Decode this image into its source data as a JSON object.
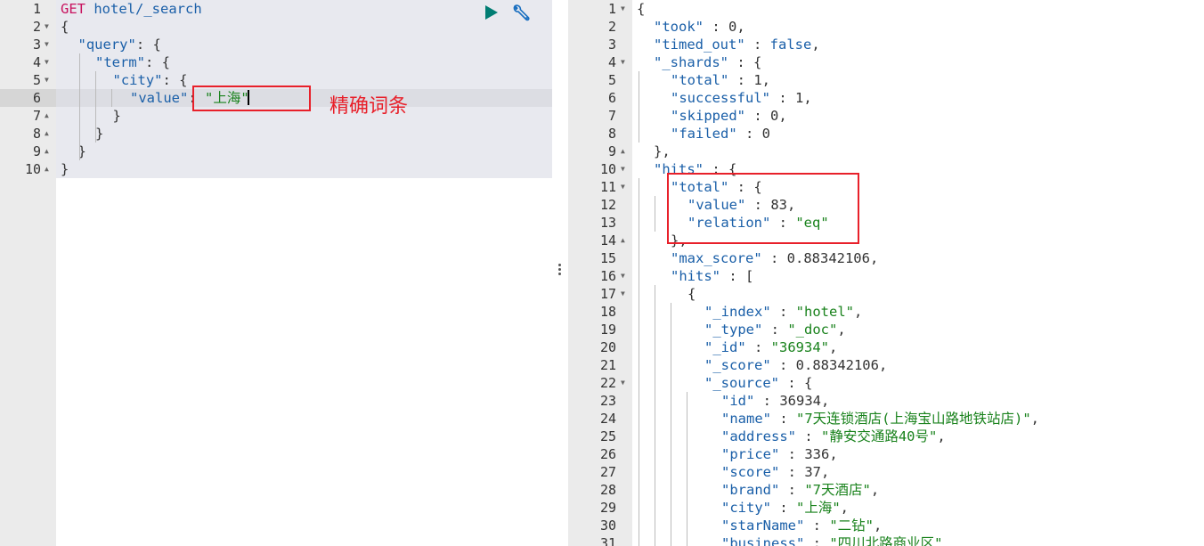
{
  "request_editor": {
    "active_line": 6,
    "lines": [
      {
        "n": "1",
        "fold": "",
        "indent": 0,
        "tokens": [
          {
            "t": "method",
            "v": "GET"
          },
          {
            "t": "punc",
            "v": " "
          },
          {
            "t": "url",
            "v": "hotel/_search"
          }
        ]
      },
      {
        "n": "2",
        "fold": "▼",
        "indent": 0,
        "tokens": [
          {
            "t": "punc",
            "v": "{"
          }
        ]
      },
      {
        "n": "3",
        "fold": "▼",
        "indent": 1,
        "tokens": [
          {
            "t": "key",
            "v": "\"query\""
          },
          {
            "t": "punc",
            "v": ": {"
          }
        ]
      },
      {
        "n": "4",
        "fold": "▼",
        "indent": 2,
        "tokens": [
          {
            "t": "key",
            "v": "\"term\""
          },
          {
            "t": "punc",
            "v": ": {"
          }
        ]
      },
      {
        "n": "5",
        "fold": "▼",
        "indent": 3,
        "tokens": [
          {
            "t": "key",
            "v": "\"city\""
          },
          {
            "t": "punc",
            "v": ": {"
          }
        ]
      },
      {
        "n": "6",
        "fold": "",
        "indent": 4,
        "tokens": [
          {
            "t": "key",
            "v": "\"value\""
          },
          {
            "t": "punc",
            "v": ": "
          },
          {
            "t": "str",
            "v": "\"上海\""
          }
        ]
      },
      {
        "n": "7",
        "fold": "▲",
        "indent": 3,
        "tokens": [
          {
            "t": "punc",
            "v": "}"
          }
        ]
      },
      {
        "n": "8",
        "fold": "▲",
        "indent": 2,
        "tokens": [
          {
            "t": "punc",
            "v": "}"
          }
        ]
      },
      {
        "n": "9",
        "fold": "▲",
        "indent": 1,
        "tokens": [
          {
            "t": "punc",
            "v": "}"
          }
        ]
      },
      {
        "n": "10",
        "fold": "▲",
        "indent": 0,
        "tokens": [
          {
            "t": "punc",
            "v": "}"
          }
        ]
      }
    ]
  },
  "toolbar": {
    "run_icon": "play-icon",
    "settings_icon": "wrench-icon",
    "run_color": "#017d73",
    "settings_color": "#1a6fc0"
  },
  "annotation": {
    "label": "精确词条",
    "color": "#e8202a"
  },
  "response_editor": {
    "lines": [
      {
        "n": "1",
        "fold": "▼",
        "indent": 0,
        "tokens": [
          {
            "t": "punc",
            "v": "{"
          }
        ]
      },
      {
        "n": "2",
        "fold": "",
        "indent": 1,
        "tokens": [
          {
            "t": "key",
            "v": "\"took\""
          },
          {
            "t": "punc",
            "v": " : "
          },
          {
            "t": "num",
            "v": "0"
          },
          {
            "t": "punc",
            "v": ","
          }
        ]
      },
      {
        "n": "3",
        "fold": "",
        "indent": 1,
        "tokens": [
          {
            "t": "key",
            "v": "\"timed_out\""
          },
          {
            "t": "punc",
            "v": " : "
          },
          {
            "t": "kw",
            "v": "false"
          },
          {
            "t": "punc",
            "v": ","
          }
        ]
      },
      {
        "n": "4",
        "fold": "▼",
        "indent": 1,
        "tokens": [
          {
            "t": "key",
            "v": "\"_shards\""
          },
          {
            "t": "punc",
            "v": " : {"
          }
        ]
      },
      {
        "n": "5",
        "fold": "",
        "indent": 2,
        "tokens": [
          {
            "t": "key",
            "v": "\"total\""
          },
          {
            "t": "punc",
            "v": " : "
          },
          {
            "t": "num",
            "v": "1"
          },
          {
            "t": "punc",
            "v": ","
          }
        ]
      },
      {
        "n": "6",
        "fold": "",
        "indent": 2,
        "tokens": [
          {
            "t": "key",
            "v": "\"successful\""
          },
          {
            "t": "punc",
            "v": " : "
          },
          {
            "t": "num",
            "v": "1"
          },
          {
            "t": "punc",
            "v": ","
          }
        ]
      },
      {
        "n": "7",
        "fold": "",
        "indent": 2,
        "tokens": [
          {
            "t": "key",
            "v": "\"skipped\""
          },
          {
            "t": "punc",
            "v": " : "
          },
          {
            "t": "num",
            "v": "0"
          },
          {
            "t": "punc",
            "v": ","
          }
        ]
      },
      {
        "n": "8",
        "fold": "",
        "indent": 2,
        "tokens": [
          {
            "t": "key",
            "v": "\"failed\""
          },
          {
            "t": "punc",
            "v": " : "
          },
          {
            "t": "num",
            "v": "0"
          }
        ]
      },
      {
        "n": "9",
        "fold": "▲",
        "indent": 1,
        "tokens": [
          {
            "t": "punc",
            "v": "},"
          }
        ]
      },
      {
        "n": "10",
        "fold": "▼",
        "indent": 1,
        "tokens": [
          {
            "t": "key",
            "v": "\"hits\""
          },
          {
            "t": "punc",
            "v": " : {"
          }
        ]
      },
      {
        "n": "11",
        "fold": "▼",
        "indent": 2,
        "tokens": [
          {
            "t": "key",
            "v": "\"total\""
          },
          {
            "t": "punc",
            "v": " : {"
          }
        ]
      },
      {
        "n": "12",
        "fold": "",
        "indent": 3,
        "tokens": [
          {
            "t": "key",
            "v": "\"value\""
          },
          {
            "t": "punc",
            "v": " : "
          },
          {
            "t": "num",
            "v": "83"
          },
          {
            "t": "punc",
            "v": ","
          }
        ]
      },
      {
        "n": "13",
        "fold": "",
        "indent": 3,
        "tokens": [
          {
            "t": "key",
            "v": "\"relation\""
          },
          {
            "t": "punc",
            "v": " : "
          },
          {
            "t": "str",
            "v": "\"eq\""
          }
        ]
      },
      {
        "n": "14",
        "fold": "▲",
        "indent": 2,
        "tokens": [
          {
            "t": "punc",
            "v": "},"
          }
        ]
      },
      {
        "n": "15",
        "fold": "",
        "indent": 2,
        "tokens": [
          {
            "t": "key",
            "v": "\"max_score\""
          },
          {
            "t": "punc",
            "v": " : "
          },
          {
            "t": "num",
            "v": "0.88342106"
          },
          {
            "t": "punc",
            "v": ","
          }
        ]
      },
      {
        "n": "16",
        "fold": "▼",
        "indent": 2,
        "tokens": [
          {
            "t": "key",
            "v": "\"hits\""
          },
          {
            "t": "punc",
            "v": " : ["
          }
        ]
      },
      {
        "n": "17",
        "fold": "▼",
        "indent": 3,
        "tokens": [
          {
            "t": "punc",
            "v": "{"
          }
        ]
      },
      {
        "n": "18",
        "fold": "",
        "indent": 4,
        "tokens": [
          {
            "t": "key",
            "v": "\"_index\""
          },
          {
            "t": "punc",
            "v": " : "
          },
          {
            "t": "str",
            "v": "\"hotel\""
          },
          {
            "t": "punc",
            "v": ","
          }
        ]
      },
      {
        "n": "19",
        "fold": "",
        "indent": 4,
        "tokens": [
          {
            "t": "key",
            "v": "\"_type\""
          },
          {
            "t": "punc",
            "v": " : "
          },
          {
            "t": "str",
            "v": "\"_doc\""
          },
          {
            "t": "punc",
            "v": ","
          }
        ]
      },
      {
        "n": "20",
        "fold": "",
        "indent": 4,
        "tokens": [
          {
            "t": "key",
            "v": "\"_id\""
          },
          {
            "t": "punc",
            "v": " : "
          },
          {
            "t": "str",
            "v": "\"36934\""
          },
          {
            "t": "punc",
            "v": ","
          }
        ]
      },
      {
        "n": "21",
        "fold": "",
        "indent": 4,
        "tokens": [
          {
            "t": "key",
            "v": "\"_score\""
          },
          {
            "t": "punc",
            "v": " : "
          },
          {
            "t": "num",
            "v": "0.88342106"
          },
          {
            "t": "punc",
            "v": ","
          }
        ]
      },
      {
        "n": "22",
        "fold": "▼",
        "indent": 4,
        "tokens": [
          {
            "t": "key",
            "v": "\"_source\""
          },
          {
            "t": "punc",
            "v": " : {"
          }
        ]
      },
      {
        "n": "23",
        "fold": "",
        "indent": 5,
        "tokens": [
          {
            "t": "key",
            "v": "\"id\""
          },
          {
            "t": "punc",
            "v": " : "
          },
          {
            "t": "num",
            "v": "36934"
          },
          {
            "t": "punc",
            "v": ","
          }
        ]
      },
      {
        "n": "24",
        "fold": "",
        "indent": 5,
        "tokens": [
          {
            "t": "key",
            "v": "\"name\""
          },
          {
            "t": "punc",
            "v": " : "
          },
          {
            "t": "str",
            "v": "\"7天连锁酒店(上海宝山路地铁站店)\""
          },
          {
            "t": "punc",
            "v": ","
          }
        ]
      },
      {
        "n": "25",
        "fold": "",
        "indent": 5,
        "tokens": [
          {
            "t": "key",
            "v": "\"address\""
          },
          {
            "t": "punc",
            "v": " : "
          },
          {
            "t": "str",
            "v": "\"静安交通路40号\""
          },
          {
            "t": "punc",
            "v": ","
          }
        ]
      },
      {
        "n": "26",
        "fold": "",
        "indent": 5,
        "tokens": [
          {
            "t": "key",
            "v": "\"price\""
          },
          {
            "t": "punc",
            "v": " : "
          },
          {
            "t": "num",
            "v": "336"
          },
          {
            "t": "punc",
            "v": ","
          }
        ]
      },
      {
        "n": "27",
        "fold": "",
        "indent": 5,
        "tokens": [
          {
            "t": "key",
            "v": "\"score\""
          },
          {
            "t": "punc",
            "v": " : "
          },
          {
            "t": "num",
            "v": "37"
          },
          {
            "t": "punc",
            "v": ","
          }
        ]
      },
      {
        "n": "28",
        "fold": "",
        "indent": 5,
        "tokens": [
          {
            "t": "key",
            "v": "\"brand\""
          },
          {
            "t": "punc",
            "v": " : "
          },
          {
            "t": "str",
            "v": "\"7天酒店\""
          },
          {
            "t": "punc",
            "v": ","
          }
        ]
      },
      {
        "n": "29",
        "fold": "",
        "indent": 5,
        "tokens": [
          {
            "t": "key",
            "v": "\"city\""
          },
          {
            "t": "punc",
            "v": " : "
          },
          {
            "t": "str",
            "v": "\"上海\""
          },
          {
            "t": "punc",
            "v": ","
          }
        ]
      },
      {
        "n": "30",
        "fold": "",
        "indent": 5,
        "tokens": [
          {
            "t": "key",
            "v": "\"starName\""
          },
          {
            "t": "punc",
            "v": " : "
          },
          {
            "t": "str",
            "v": "\"二钻\""
          },
          {
            "t": "punc",
            "v": ","
          }
        ]
      },
      {
        "n": "31",
        "fold": "",
        "indent": 5,
        "tokens": [
          {
            "t": "key",
            "v": "\"business\""
          },
          {
            "t": "punc",
            "v": " : "
          },
          {
            "t": "str",
            "v": "\"四川北路商业区\""
          }
        ]
      }
    ]
  }
}
